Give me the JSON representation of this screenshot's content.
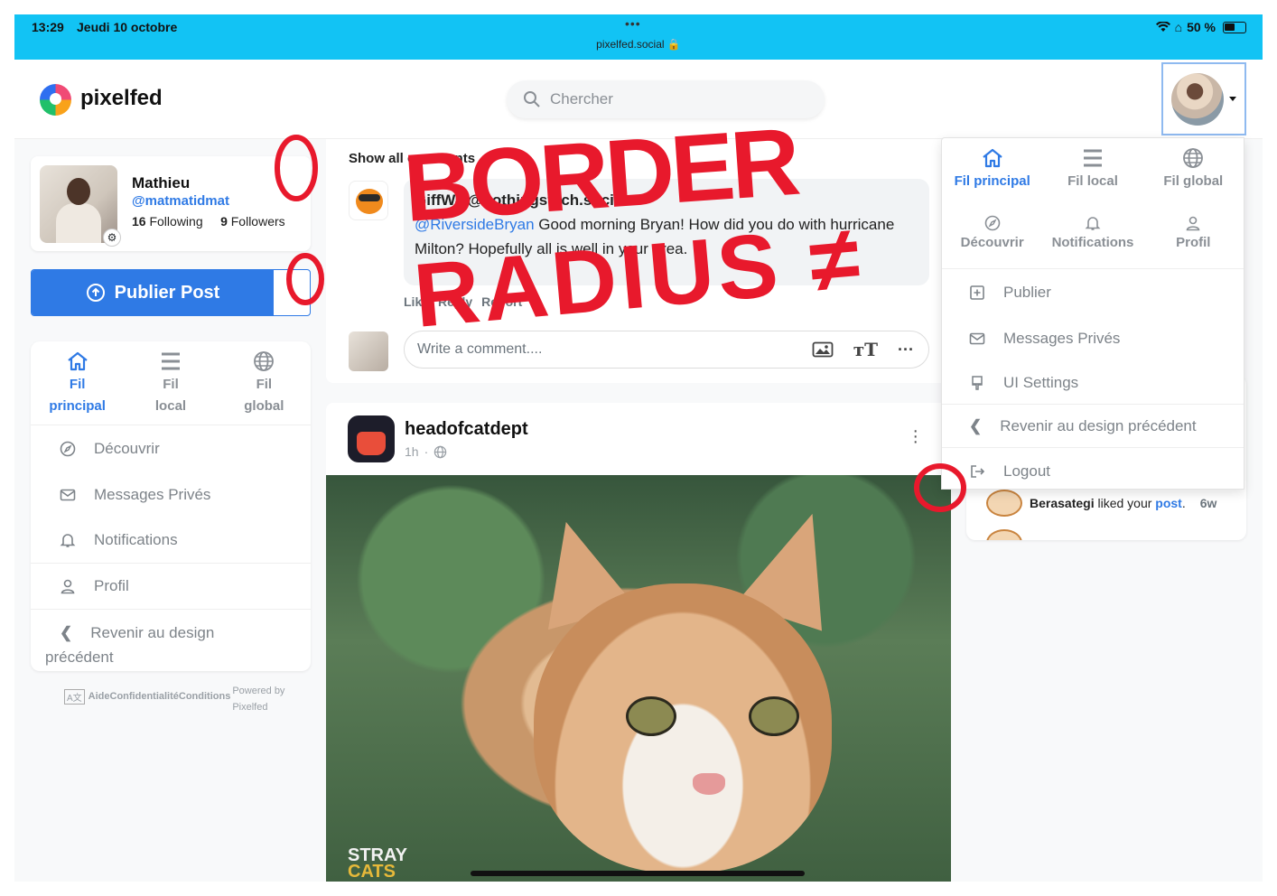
{
  "status_bar": {
    "time": "13:29",
    "date": "Jeudi 10 octobre",
    "dots": "•••",
    "url": "pixelfed.social",
    "battery": "50 %"
  },
  "navbar": {
    "brand": "pixelfed",
    "search_placeholder": "Chercher"
  },
  "profile": {
    "name": "Mathieu",
    "handle": "@matmatidmat",
    "following_count": "16",
    "following_label": "Following",
    "followers_count": "9",
    "followers_label": "Followers"
  },
  "publish_button": "Publier Post",
  "left_nav": {
    "tabs": [
      {
        "line1": "Fil",
        "line2": "principal"
      },
      {
        "line1": "Fil",
        "line2": "local"
      },
      {
        "line1": "Fil",
        "line2": "global"
      }
    ],
    "items": [
      "Découvrir",
      "Messages Privés",
      "Notifications",
      "Profil"
    ],
    "back_line1": "Revenir au design",
    "back_line2": "précédent"
  },
  "footer": {
    "lang": "A文",
    "links": "AideConfidentialitéConditions",
    "powered": "Powered by Pixelfed"
  },
  "comments": {
    "show_all": "Show all comments",
    "author": "GiffWa @nothingstech.social",
    "mention": "@RiversideBryan",
    "text": " Good morning Bryan! How did you do with hurricane Milton? Hopefully all is well in your area.",
    "actions": [
      "Like",
      "Reply",
      "Report"
    ],
    "compose_placeholder": "Write a comment...."
  },
  "post": {
    "username": "headofcatdept",
    "age": "1h",
    "watermark_line1": "STRAY",
    "watermark_line2": "CATS"
  },
  "notification": {
    "user": "Berasategi",
    "text": " liked your ",
    "link": "post",
    "period": ".",
    "age": "6w"
  },
  "dropdown": {
    "tabs": [
      "Fil principal",
      "Fil local",
      "Fil global"
    ],
    "sub": [
      "Découvrir",
      "Notifications",
      "Profil"
    ],
    "items": [
      "Publier",
      "Messages Privés",
      "UI Settings",
      "Revenir au design précédent",
      "Logout"
    ]
  },
  "annotations": {
    "line1": "BORDER",
    "line2": "RADIUS ≠",
    "circle_marks": [
      "0",
      "0",
      "0"
    ]
  },
  "colors": {
    "accent": "#2f7ae5",
    "status_bar": "#12c3f4",
    "annotation": "#e8192c"
  }
}
